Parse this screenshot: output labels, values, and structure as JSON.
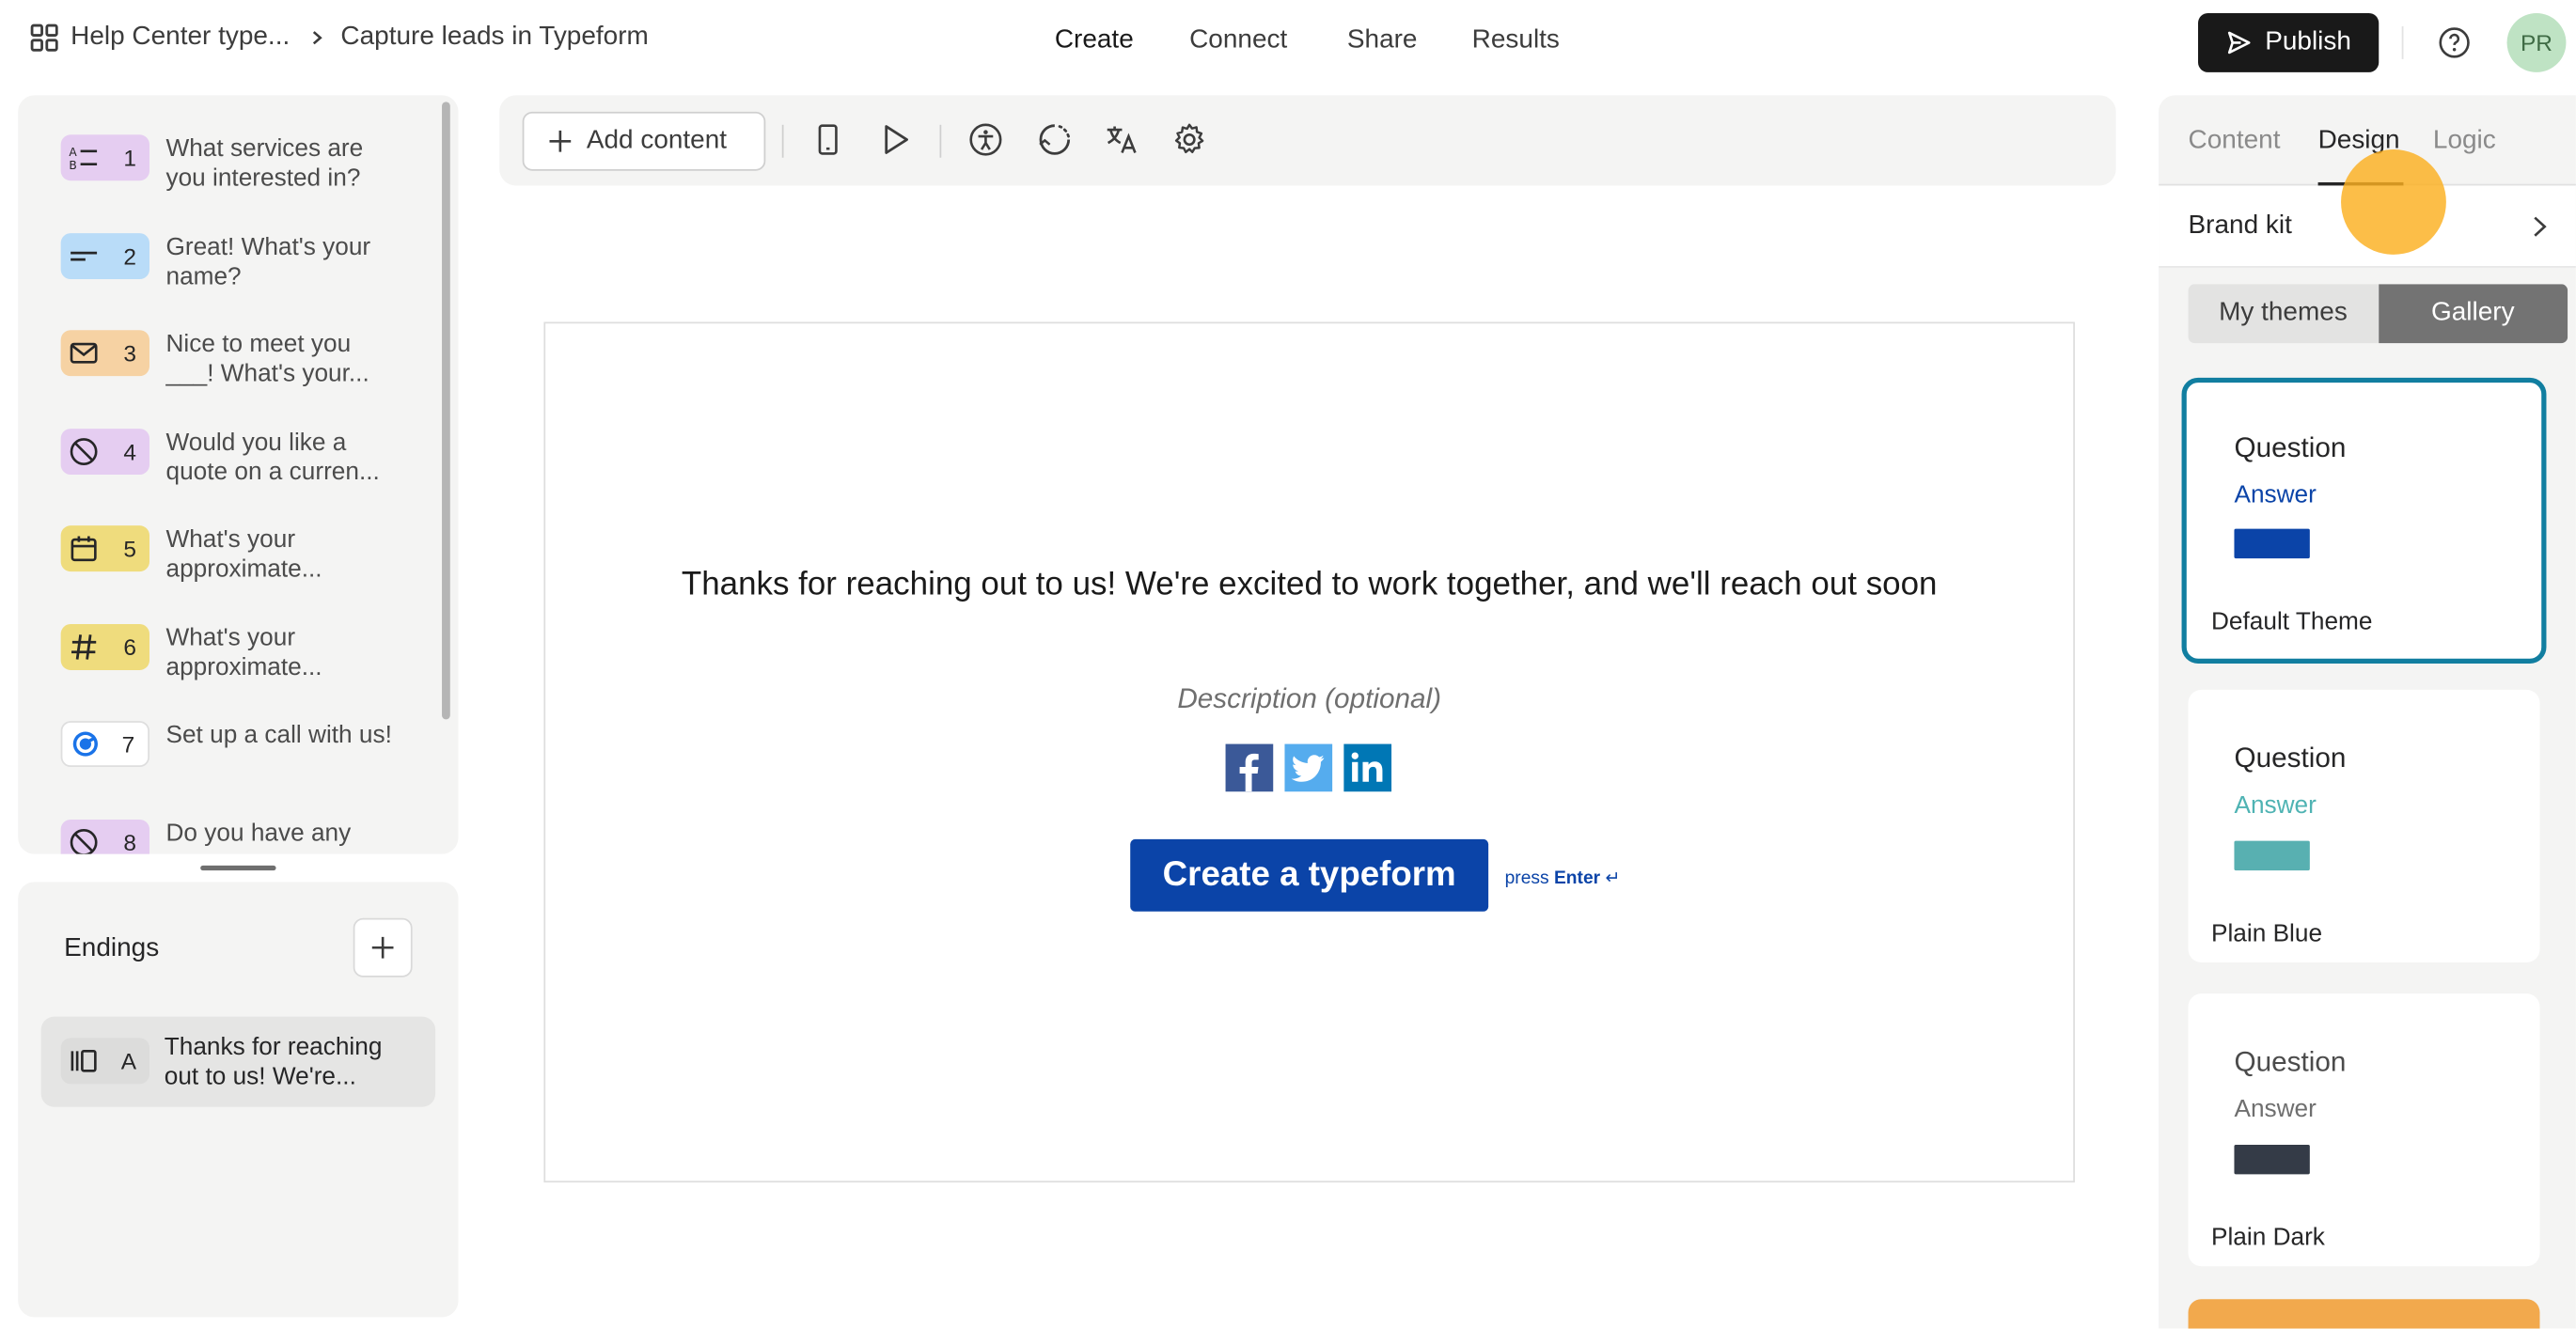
{
  "breadcrumb": {
    "workspace": "Help Center type...",
    "form": "Capture leads in Typeform"
  },
  "nav": {
    "create": "Create",
    "connect": "Connect",
    "share": "Share",
    "results": "Results"
  },
  "header": {
    "publish_label": "Publish",
    "avatar_initials": "PR"
  },
  "questions": [
    {
      "num": "1",
      "text": "What services are you interested in?",
      "icon": "multiple-choice-icon",
      "color": "#e5cdf1"
    },
    {
      "num": "2",
      "text": "Great! What's your name?",
      "icon": "short-text-icon",
      "color": "#b9dcf8"
    },
    {
      "num": "3",
      "text": "Nice to meet you ___! What's your...",
      "icon": "email-icon",
      "color": "#f6d2a3"
    },
    {
      "num": "4",
      "text": "Would you like a quote on a curren...",
      "icon": "no-entry-icon",
      "color": "#e5cdf1"
    },
    {
      "num": "5",
      "text": "What's your approximate...",
      "icon": "calendar-icon",
      "color": "#efdc7d"
    },
    {
      "num": "6",
      "text": "What's your approximate...",
      "icon": "hashtag-icon",
      "color": "#efdc7d"
    },
    {
      "num": "7",
      "text": "Set up a call with us!",
      "icon": "calendly-icon",
      "color": "#ffffff"
    },
    {
      "num": "8",
      "text": "Do you have any",
      "icon": "no-entry-icon",
      "color": "#e5cdf1"
    }
  ],
  "endings": {
    "title": "Endings",
    "items": [
      {
        "letter": "A",
        "text": "Thanks for reaching out to us! We're...",
        "icon": "ending-icon",
        "color": "#dcdcdb"
      }
    ]
  },
  "toolbar": {
    "add_content_label": "Add content",
    "icons": [
      "mobile-preview-icon",
      "play-icon",
      "accessibility-icon",
      "loading-icon",
      "translate-icon",
      "settings-icon"
    ]
  },
  "canvas": {
    "message": "Thanks for reaching out to us! We're excited to work together, and we'll reach out soon",
    "description_placeholder": "Description (optional)",
    "social": [
      "facebook-icon",
      "twitter-icon",
      "linkedin-icon"
    ],
    "cta_label": "Create a typeform",
    "hint_press": "press",
    "hint_key": "Enter",
    "hint_symbol": "↵",
    "accent_color": "#0b44a8"
  },
  "panel": {
    "tabs": [
      "Content",
      "Design",
      "Logic"
    ],
    "active_tab": "Design",
    "brand_kit_label": "Brand kit",
    "segments": [
      "My themes",
      "Gallery"
    ],
    "active_segment": "Gallery",
    "themes": [
      {
        "question": "Question",
        "answer": "Answer",
        "name": "Default Theme",
        "answer_color": "#0b44a8",
        "swatch": "#0b44a8",
        "selected": true
      },
      {
        "question": "Question",
        "answer": "Answer",
        "name": "Plain Blue",
        "answer_color": "#4fb3b3",
        "swatch": "#58b0b1",
        "selected": false
      },
      {
        "question": "Question",
        "answer": "Answer",
        "name": "Plain Dark",
        "answer_color": "#6f6f6f",
        "swatch": "#343b47",
        "selected": false
      }
    ]
  }
}
